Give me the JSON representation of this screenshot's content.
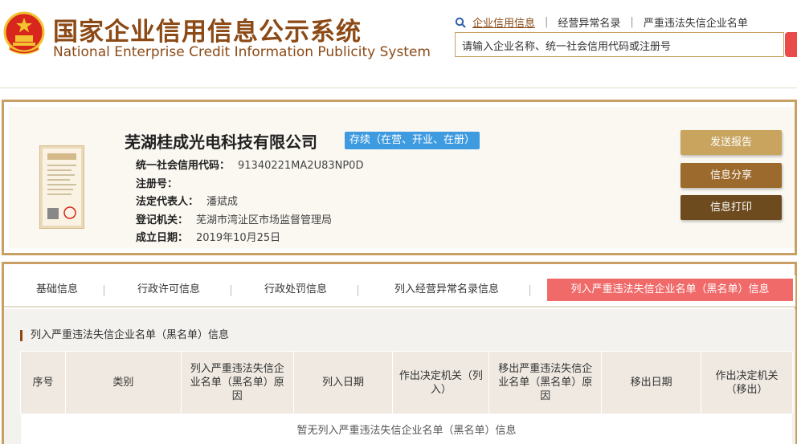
{
  "header": {
    "title_cn": "国家企业信用信息公示系统",
    "title_en": "National Enterprise Credit Information Publicity System",
    "nav": [
      {
        "label": "企业信用信息",
        "active": true
      },
      {
        "label": "经营异常名录",
        "active": false
      },
      {
        "label": "严重违法失信企业名单",
        "active": false
      }
    ],
    "search_placeholder": "请输入企业名称、统一社会信用代码或注册号"
  },
  "company": {
    "name": "芜湖桂成光电科技有限公司",
    "status": "存续（在营、开业、在册）",
    "license_text": "营业执照",
    "fields": [
      {
        "label": "统一社会信用代码：",
        "value": "91340221MA2U83NP0D"
      },
      {
        "label": "注册号：",
        "value": ""
      },
      {
        "label": "法定代表人：",
        "value": "潘斌成"
      },
      {
        "label": "登记机关：",
        "value": "芜湖市湾沚区市场监督管理局"
      },
      {
        "label": "成立日期：",
        "value": "2019年10月25日"
      }
    ],
    "actions": {
      "report": "发送报告",
      "share": "信息分享",
      "print": "信息打印"
    }
  },
  "tabs": [
    {
      "label": "基础信息",
      "active": false
    },
    {
      "label": "行政许可信息",
      "active": false
    },
    {
      "label": "行政处罚信息",
      "active": false
    },
    {
      "label": "列入经营异常名录信息",
      "active": false
    },
    {
      "label": "列入严重违法失信企业名单（黑名单）信息",
      "active": true
    }
  ],
  "section": {
    "title": "列入严重违法失信企业名单（黑名单）信息",
    "columns": [
      "序号",
      "类别",
      "列入严重违法失信企业名单（黑名单）原因",
      "列入日期",
      "作出决定机关（列入）",
      "移出严重违法失信企业名单（黑名单）原因",
      "移出日期",
      "作出决定机关（移出）"
    ],
    "empty_message": "暂无列入严重违法失信企业名单（黑名单）信息"
  },
  "colors": {
    "brand_brown": "#8b4a16",
    "gold_border": "#c9a063",
    "status_blue": "#3f9be0",
    "active_tab_red": "#f06a6a"
  }
}
